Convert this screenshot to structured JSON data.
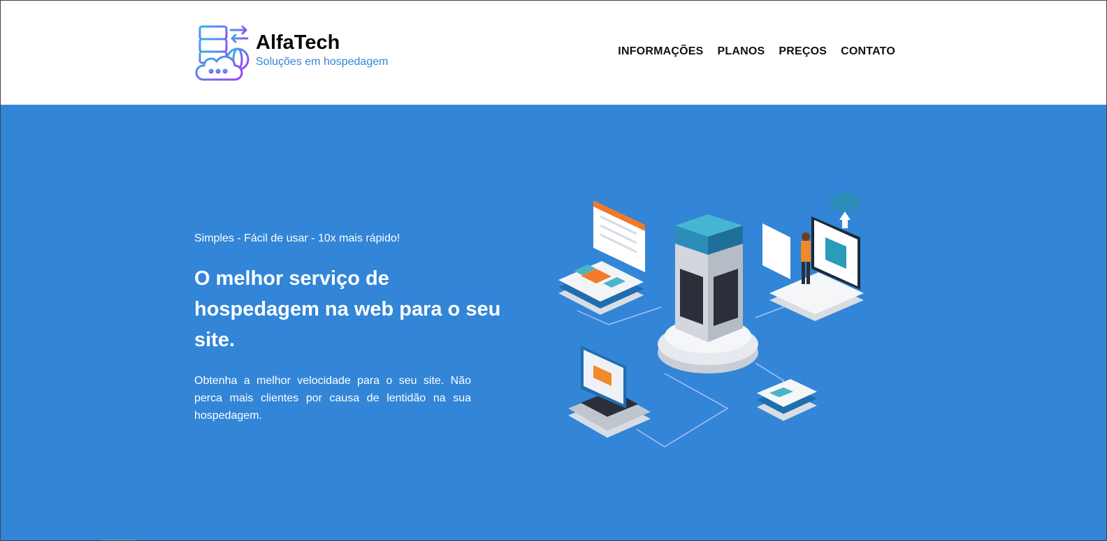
{
  "brand": {
    "name": "AlfaTech",
    "tagline": "Soluções em hospedagem",
    "logo_icon": "server-cloud-icon"
  },
  "nav": {
    "items": [
      {
        "label": "INFORMAÇÕES"
      },
      {
        "label": "PLANOS"
      },
      {
        "label": "PREÇOS"
      },
      {
        "label": "CONTATO"
      }
    ]
  },
  "hero": {
    "kicker": "Simples - Fácil de usar - 10x mais rápido!",
    "title": "O melhor serviço de hospedagem na web para o seu site.",
    "description": "Obtenha a melhor velocidade para o seu site. Não perca mais clientes por causa de lentidão na sua hospedagem.",
    "illustration": "isometric-hosting-server-illustration"
  },
  "colors": {
    "hero_bg": "#3285d7",
    "tagline": "#3484d6",
    "logo_gradient_start": "#2bb3e6",
    "logo_gradient_end": "#a13df0"
  }
}
